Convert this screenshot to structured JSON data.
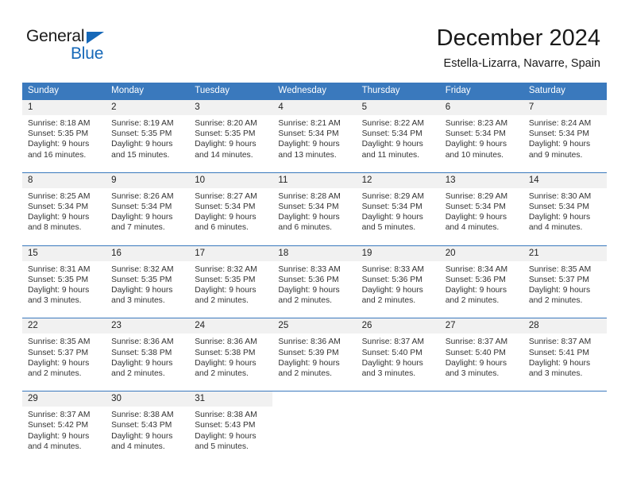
{
  "logo": {
    "word_one": "General",
    "word_two": "Blue",
    "triangle_icon": "triangle-icon",
    "accent_color": "#1668b8"
  },
  "header": {
    "title": "December 2024",
    "subtitle": "Estella-Lizarra, Navarre, Spain"
  },
  "calendar": {
    "header_color": "#3a79bd",
    "weekdays": [
      "Sunday",
      "Monday",
      "Tuesday",
      "Wednesday",
      "Thursday",
      "Friday",
      "Saturday"
    ],
    "weeks": [
      [
        {
          "day": "1",
          "sunrise": "Sunrise: 8:18 AM",
          "sunset": "Sunset: 5:35 PM",
          "daylight_line1": "Daylight: 9 hours",
          "daylight_line2": "and 16 minutes."
        },
        {
          "day": "2",
          "sunrise": "Sunrise: 8:19 AM",
          "sunset": "Sunset: 5:35 PM",
          "daylight_line1": "Daylight: 9 hours",
          "daylight_line2": "and 15 minutes."
        },
        {
          "day": "3",
          "sunrise": "Sunrise: 8:20 AM",
          "sunset": "Sunset: 5:35 PM",
          "daylight_line1": "Daylight: 9 hours",
          "daylight_line2": "and 14 minutes."
        },
        {
          "day": "4",
          "sunrise": "Sunrise: 8:21 AM",
          "sunset": "Sunset: 5:34 PM",
          "daylight_line1": "Daylight: 9 hours",
          "daylight_line2": "and 13 minutes."
        },
        {
          "day": "5",
          "sunrise": "Sunrise: 8:22 AM",
          "sunset": "Sunset: 5:34 PM",
          "daylight_line1": "Daylight: 9 hours",
          "daylight_line2": "and 11 minutes."
        },
        {
          "day": "6",
          "sunrise": "Sunrise: 8:23 AM",
          "sunset": "Sunset: 5:34 PM",
          "daylight_line1": "Daylight: 9 hours",
          "daylight_line2": "and 10 minutes."
        },
        {
          "day": "7",
          "sunrise": "Sunrise: 8:24 AM",
          "sunset": "Sunset: 5:34 PM",
          "daylight_line1": "Daylight: 9 hours",
          "daylight_line2": "and 9 minutes."
        }
      ],
      [
        {
          "day": "8",
          "sunrise": "Sunrise: 8:25 AM",
          "sunset": "Sunset: 5:34 PM",
          "daylight_line1": "Daylight: 9 hours",
          "daylight_line2": "and 8 minutes."
        },
        {
          "day": "9",
          "sunrise": "Sunrise: 8:26 AM",
          "sunset": "Sunset: 5:34 PM",
          "daylight_line1": "Daylight: 9 hours",
          "daylight_line2": "and 7 minutes."
        },
        {
          "day": "10",
          "sunrise": "Sunrise: 8:27 AM",
          "sunset": "Sunset: 5:34 PM",
          "daylight_line1": "Daylight: 9 hours",
          "daylight_line2": "and 6 minutes."
        },
        {
          "day": "11",
          "sunrise": "Sunrise: 8:28 AM",
          "sunset": "Sunset: 5:34 PM",
          "daylight_line1": "Daylight: 9 hours",
          "daylight_line2": "and 6 minutes."
        },
        {
          "day": "12",
          "sunrise": "Sunrise: 8:29 AM",
          "sunset": "Sunset: 5:34 PM",
          "daylight_line1": "Daylight: 9 hours",
          "daylight_line2": "and 5 minutes."
        },
        {
          "day": "13",
          "sunrise": "Sunrise: 8:29 AM",
          "sunset": "Sunset: 5:34 PM",
          "daylight_line1": "Daylight: 9 hours",
          "daylight_line2": "and 4 minutes."
        },
        {
          "day": "14",
          "sunrise": "Sunrise: 8:30 AM",
          "sunset": "Sunset: 5:34 PM",
          "daylight_line1": "Daylight: 9 hours",
          "daylight_line2": "and 4 minutes."
        }
      ],
      [
        {
          "day": "15",
          "sunrise": "Sunrise: 8:31 AM",
          "sunset": "Sunset: 5:35 PM",
          "daylight_line1": "Daylight: 9 hours",
          "daylight_line2": "and 3 minutes."
        },
        {
          "day": "16",
          "sunrise": "Sunrise: 8:32 AM",
          "sunset": "Sunset: 5:35 PM",
          "daylight_line1": "Daylight: 9 hours",
          "daylight_line2": "and 3 minutes."
        },
        {
          "day": "17",
          "sunrise": "Sunrise: 8:32 AM",
          "sunset": "Sunset: 5:35 PM",
          "daylight_line1": "Daylight: 9 hours",
          "daylight_line2": "and 2 minutes."
        },
        {
          "day": "18",
          "sunrise": "Sunrise: 8:33 AM",
          "sunset": "Sunset: 5:36 PM",
          "daylight_line1": "Daylight: 9 hours",
          "daylight_line2": "and 2 minutes."
        },
        {
          "day": "19",
          "sunrise": "Sunrise: 8:33 AM",
          "sunset": "Sunset: 5:36 PM",
          "daylight_line1": "Daylight: 9 hours",
          "daylight_line2": "and 2 minutes."
        },
        {
          "day": "20",
          "sunrise": "Sunrise: 8:34 AM",
          "sunset": "Sunset: 5:36 PM",
          "daylight_line1": "Daylight: 9 hours",
          "daylight_line2": "and 2 minutes."
        },
        {
          "day": "21",
          "sunrise": "Sunrise: 8:35 AM",
          "sunset": "Sunset: 5:37 PM",
          "daylight_line1": "Daylight: 9 hours",
          "daylight_line2": "and 2 minutes."
        }
      ],
      [
        {
          "day": "22",
          "sunrise": "Sunrise: 8:35 AM",
          "sunset": "Sunset: 5:37 PM",
          "daylight_line1": "Daylight: 9 hours",
          "daylight_line2": "and 2 minutes."
        },
        {
          "day": "23",
          "sunrise": "Sunrise: 8:36 AM",
          "sunset": "Sunset: 5:38 PM",
          "daylight_line1": "Daylight: 9 hours",
          "daylight_line2": "and 2 minutes."
        },
        {
          "day": "24",
          "sunrise": "Sunrise: 8:36 AM",
          "sunset": "Sunset: 5:38 PM",
          "daylight_line1": "Daylight: 9 hours",
          "daylight_line2": "and 2 minutes."
        },
        {
          "day": "25",
          "sunrise": "Sunrise: 8:36 AM",
          "sunset": "Sunset: 5:39 PM",
          "daylight_line1": "Daylight: 9 hours",
          "daylight_line2": "and 2 minutes."
        },
        {
          "day": "26",
          "sunrise": "Sunrise: 8:37 AM",
          "sunset": "Sunset: 5:40 PM",
          "daylight_line1": "Daylight: 9 hours",
          "daylight_line2": "and 3 minutes."
        },
        {
          "day": "27",
          "sunrise": "Sunrise: 8:37 AM",
          "sunset": "Sunset: 5:40 PM",
          "daylight_line1": "Daylight: 9 hours",
          "daylight_line2": "and 3 minutes."
        },
        {
          "day": "28",
          "sunrise": "Sunrise: 8:37 AM",
          "sunset": "Sunset: 5:41 PM",
          "daylight_line1": "Daylight: 9 hours",
          "daylight_line2": "and 3 minutes."
        }
      ],
      [
        {
          "day": "29",
          "sunrise": "Sunrise: 8:37 AM",
          "sunset": "Sunset: 5:42 PM",
          "daylight_line1": "Daylight: 9 hours",
          "daylight_line2": "and 4 minutes."
        },
        {
          "day": "30",
          "sunrise": "Sunrise: 8:38 AM",
          "sunset": "Sunset: 5:43 PM",
          "daylight_line1": "Daylight: 9 hours",
          "daylight_line2": "and 4 minutes."
        },
        {
          "day": "31",
          "sunrise": "Sunrise: 8:38 AM",
          "sunset": "Sunset: 5:43 PM",
          "daylight_line1": "Daylight: 9 hours",
          "daylight_line2": "and 5 minutes."
        },
        {
          "day": "",
          "sunrise": "",
          "sunset": "",
          "daylight_line1": "",
          "daylight_line2": ""
        },
        {
          "day": "",
          "sunrise": "",
          "sunset": "",
          "daylight_line1": "",
          "daylight_line2": ""
        },
        {
          "day": "",
          "sunrise": "",
          "sunset": "",
          "daylight_line1": "",
          "daylight_line2": ""
        },
        {
          "day": "",
          "sunrise": "",
          "sunset": "",
          "daylight_line1": "",
          "daylight_line2": ""
        }
      ]
    ]
  }
}
